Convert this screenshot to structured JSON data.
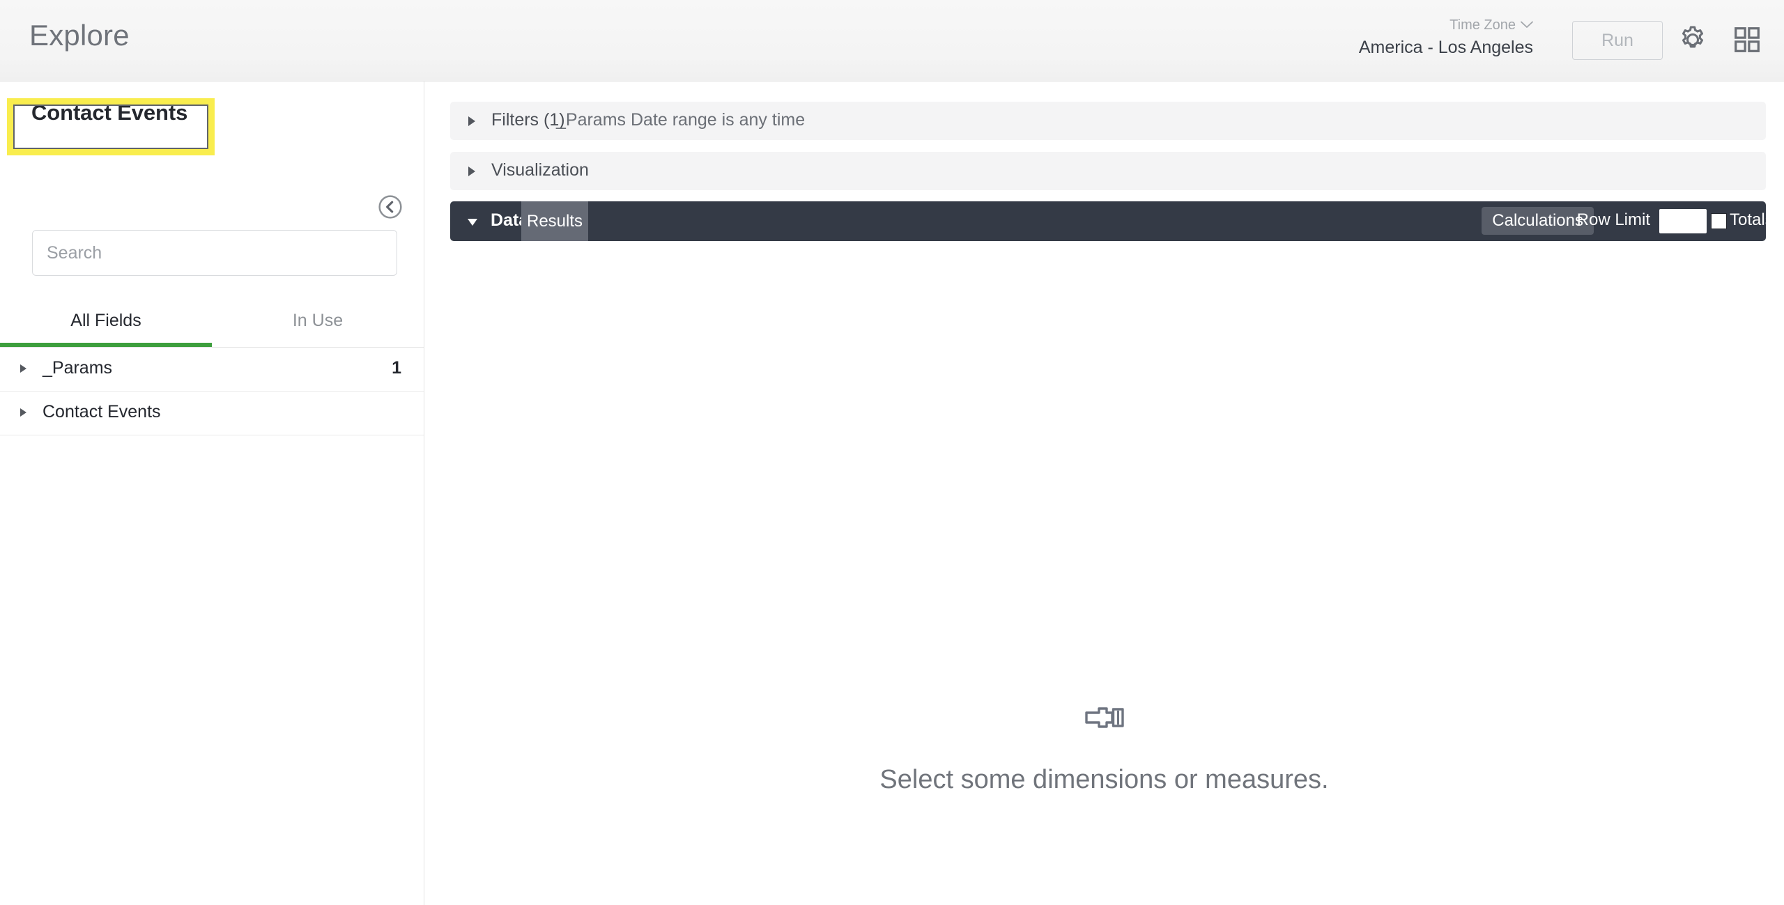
{
  "header": {
    "app_title": "Explore",
    "timezone_label": "Time Zone",
    "timezone_value": "America - Los Angeles",
    "run_label": "Run",
    "gear_icon": "gear-icon",
    "grid_icon": "grid-apps-icon"
  },
  "sidebar": {
    "explore_name": "Contact Events",
    "collapse_icon": "chevron-left-circle-icon",
    "search_placeholder": "Search",
    "search_value": "",
    "tabs": [
      {
        "label": "All Fields",
        "active": true
      },
      {
        "label": "In Use",
        "active": false
      }
    ],
    "field_groups": [
      {
        "label": "_Params",
        "count": "1"
      },
      {
        "label": "Contact Events",
        "count": ""
      }
    ]
  },
  "main": {
    "filters": {
      "title": "Filters (1)",
      "summary": "_Params Date range is any time"
    },
    "visualization": {
      "title": "Visualization"
    },
    "data": {
      "title": "Data",
      "results_tab": "Results",
      "calculations_label": "Calculations",
      "row_limit_label": "Row Limit",
      "row_limit_value": "",
      "totals_label": "Totals",
      "totals_checked": false
    },
    "empty_state": {
      "icon": "explore-flashlight-icon",
      "message": "Select some dimensions or measures."
    }
  },
  "annotation": {
    "highlight_color": "#f9ed4e",
    "target": "explore-name"
  },
  "colors": {
    "accent_green": "#3d9e3d",
    "toolbar_dark": "#343a46",
    "bar_light": "#f4f4f5"
  }
}
